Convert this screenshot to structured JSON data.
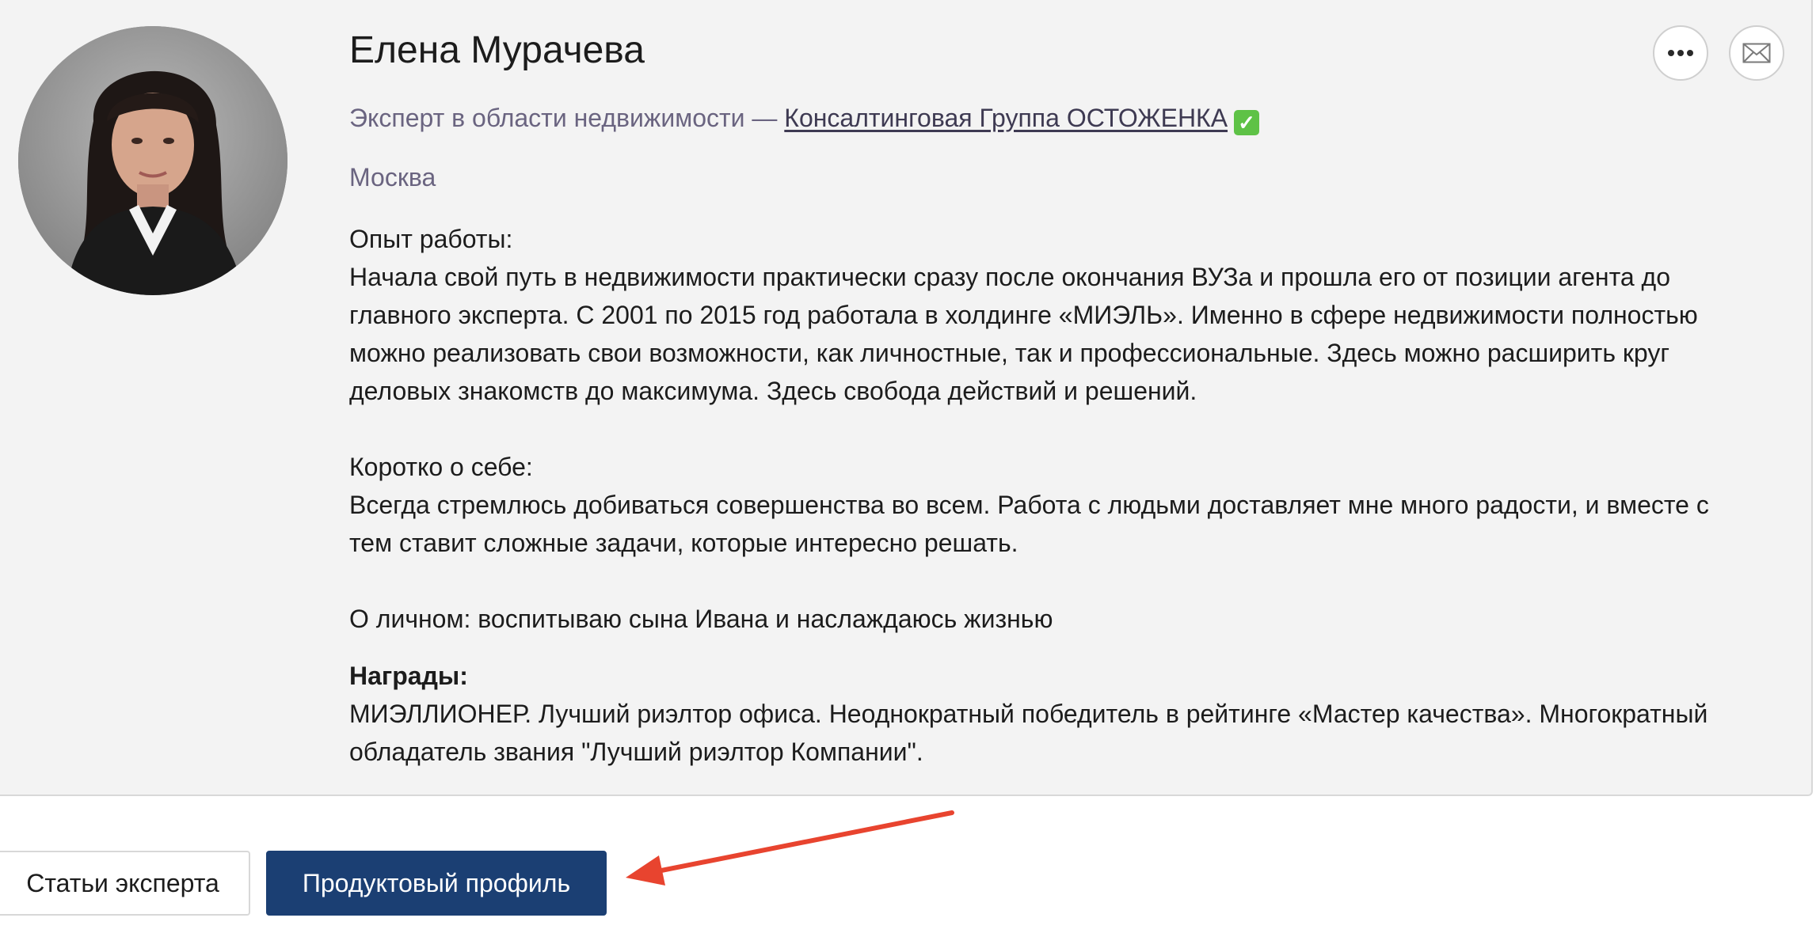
{
  "profile": {
    "name": "Елена Мурачева",
    "role_prefix": "Эксперт в области недвижимости — ",
    "company": "Консалтинговая Группа ОСТОЖЕНКА",
    "verified_icon": "check-mark-icon",
    "city": "Москва"
  },
  "bio": {
    "experience_heading": "Опыт работы:",
    "experience_lines": [
      "Начала свой путь в недвижимости практически сразу после окончания ВУЗа и прошла его от позиции агента до",
      "главного эксперта. С 2001 по 2015 год работала в холдинге «МИЭЛЬ». Именно в сфере недвижимости полностью",
      "можно реализовать свои возможности, как личностные, так и профессиональные. Здесь можно расширить круг",
      "деловых знакомств до максимума. Здесь свобода действий и решений."
    ],
    "about_heading": "Коротко о себе:",
    "about_lines": [
      "Всегда стремлюсь добиваться совершенства во всем. Работа с людьми доставляет мне много радости, и вместе с",
      "тем ставит сложные задачи, которые интересно решать."
    ],
    "personal": "О личном: воспитываю сына Ивана и наслаждаюсь жизнью",
    "awards_heading": "Награды:",
    "awards_lines": [
      "МИЭЛЛИОНЕР. Лучший риэлтор офиса. Неоднократный победитель в рейтинге «Мастер качества». Многократный",
      "обладатель звания \"Лучший риэлтор Компании\"."
    ]
  },
  "actions": {
    "more_icon": "more-dots-icon",
    "mail_icon": "envelope-icon"
  },
  "buttons": {
    "articles": "Статьи эксперта",
    "product_profile": "Продуктовый профиль"
  },
  "colors": {
    "card_bg": "#f3f3f3",
    "primary_button": "#1b3f73",
    "secondary_text": "#6a6480",
    "annotation_arrow": "#e8442f"
  }
}
